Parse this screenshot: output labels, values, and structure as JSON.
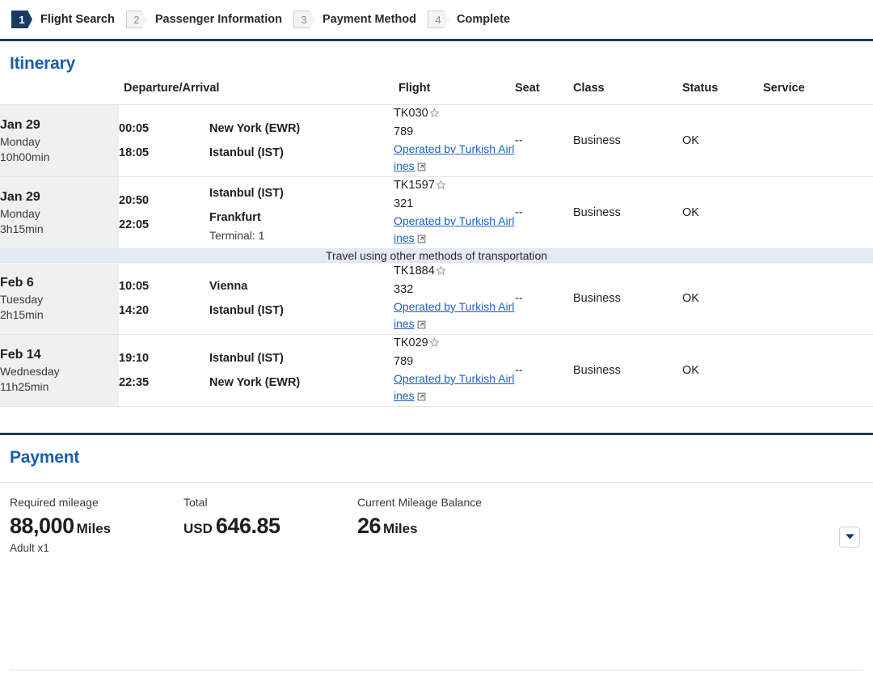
{
  "steps": [
    {
      "num": "1",
      "label": "Flight Search",
      "state": "active"
    },
    {
      "num": "2",
      "label": "Passenger Information",
      "state": "inactive"
    },
    {
      "num": "3",
      "label": "Payment Method",
      "state": "inactive"
    },
    {
      "num": "4",
      "label": "Complete",
      "state": "inactive"
    }
  ],
  "itinerary": {
    "title": "Itinerary",
    "columns": {
      "date": "",
      "departure_arrival": "Departure/Arrival",
      "flight": "Flight",
      "seat": "Seat",
      "class": "Class",
      "status": "Status",
      "service": "Service"
    },
    "banner": "Travel using other methods of transportation",
    "rows": [
      {
        "date": "Jan 29",
        "weekday": "Monday",
        "duration": "10h00min",
        "dep_time": "00:05",
        "arr_time": "18:05",
        "dep_place": "New York (EWR)",
        "arr_place": "Istanbul (IST)",
        "terminal": "",
        "flight_no": "TK030",
        "aircraft": "789",
        "operated_by": "Operated by Turkish Airlines",
        "seat": "--",
        "class": "Business",
        "status": "OK",
        "service": ""
      },
      {
        "date": "Jan 29",
        "weekday": "Monday",
        "duration": "3h15min",
        "dep_time": "20:50",
        "arr_time": "22:05",
        "dep_place": "Istanbul (IST)",
        "arr_place": "Frankfurt",
        "terminal": "Terminal: 1",
        "flight_no": "TK1597",
        "aircraft": "321",
        "operated_by": "Operated by Turkish Airlines",
        "seat": "--",
        "class": "Business",
        "status": "OK",
        "service": ""
      },
      {
        "date": "Feb 6",
        "weekday": "Tuesday",
        "duration": "2h15min",
        "dep_time": "10:05",
        "arr_time": "14:20",
        "dep_place": "Vienna",
        "arr_place": "Istanbul (IST)",
        "terminal": "",
        "flight_no": "TK1884",
        "aircraft": "332",
        "operated_by": "Operated by Turkish Airlines",
        "seat": "--",
        "class": "Business",
        "status": "OK",
        "service": ""
      },
      {
        "date": "Feb 14",
        "weekday": "Wednesday",
        "duration": "11h25min",
        "dep_time": "19:10",
        "arr_time": "22:35",
        "dep_place": "Istanbul (IST)",
        "arr_place": "New York (EWR)",
        "terminal": "",
        "flight_no": "TK029",
        "aircraft": "789",
        "operated_by": "Operated by Turkish Airlines",
        "seat": "--",
        "class": "Business",
        "status": "OK",
        "service": ""
      }
    ]
  },
  "payment": {
    "title": "Payment",
    "required_label": "Required mileage",
    "required_value": "88,000",
    "required_unit": "Miles",
    "required_note": "Adult x1",
    "total_label": "Total",
    "total_currency": "USD",
    "total_value": "646.85",
    "balance_label": "Current Mileage Balance",
    "balance_value": "26",
    "balance_unit": "Miles"
  },
  "icons": {
    "star": "star-icon",
    "external_link": "external-link-icon",
    "chevron_down": "chevron-down-icon"
  },
  "colors": {
    "navy": "#1b3a63",
    "heading_blue": "#1b5fa8",
    "link_blue": "#1f63c4",
    "banner_bg": "#e3eaf6",
    "date_bg": "#f0f0f0"
  }
}
